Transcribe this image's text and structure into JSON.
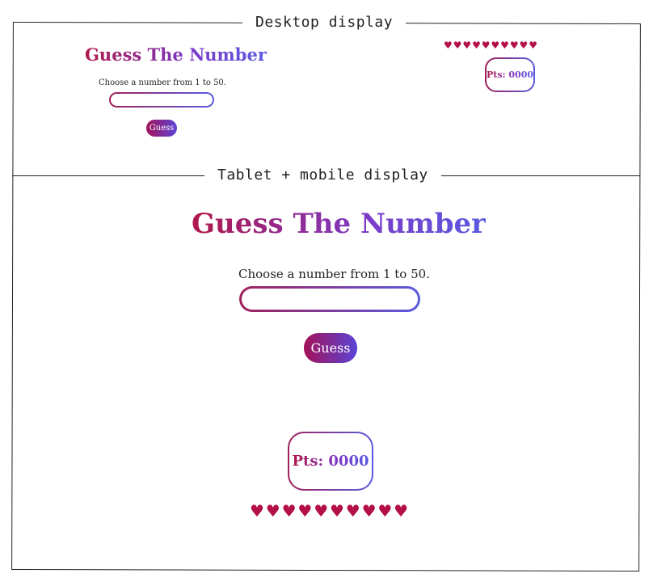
{
  "sections": {
    "desktop_label": "Desktop display",
    "mobile_label": "Tablet + mobile display"
  },
  "game": {
    "title": "Guess The Number",
    "prompt": "Choose a number from 1 to 50.",
    "input_value": "",
    "guess_button": "Guess",
    "score_label": "Pts: 0000",
    "lives": 10,
    "heart_icon": "heart-icon",
    "colors": {
      "gradient_start": "#b0174a",
      "gradient_end": "#5a5be0",
      "heart": "#b3104a"
    }
  }
}
